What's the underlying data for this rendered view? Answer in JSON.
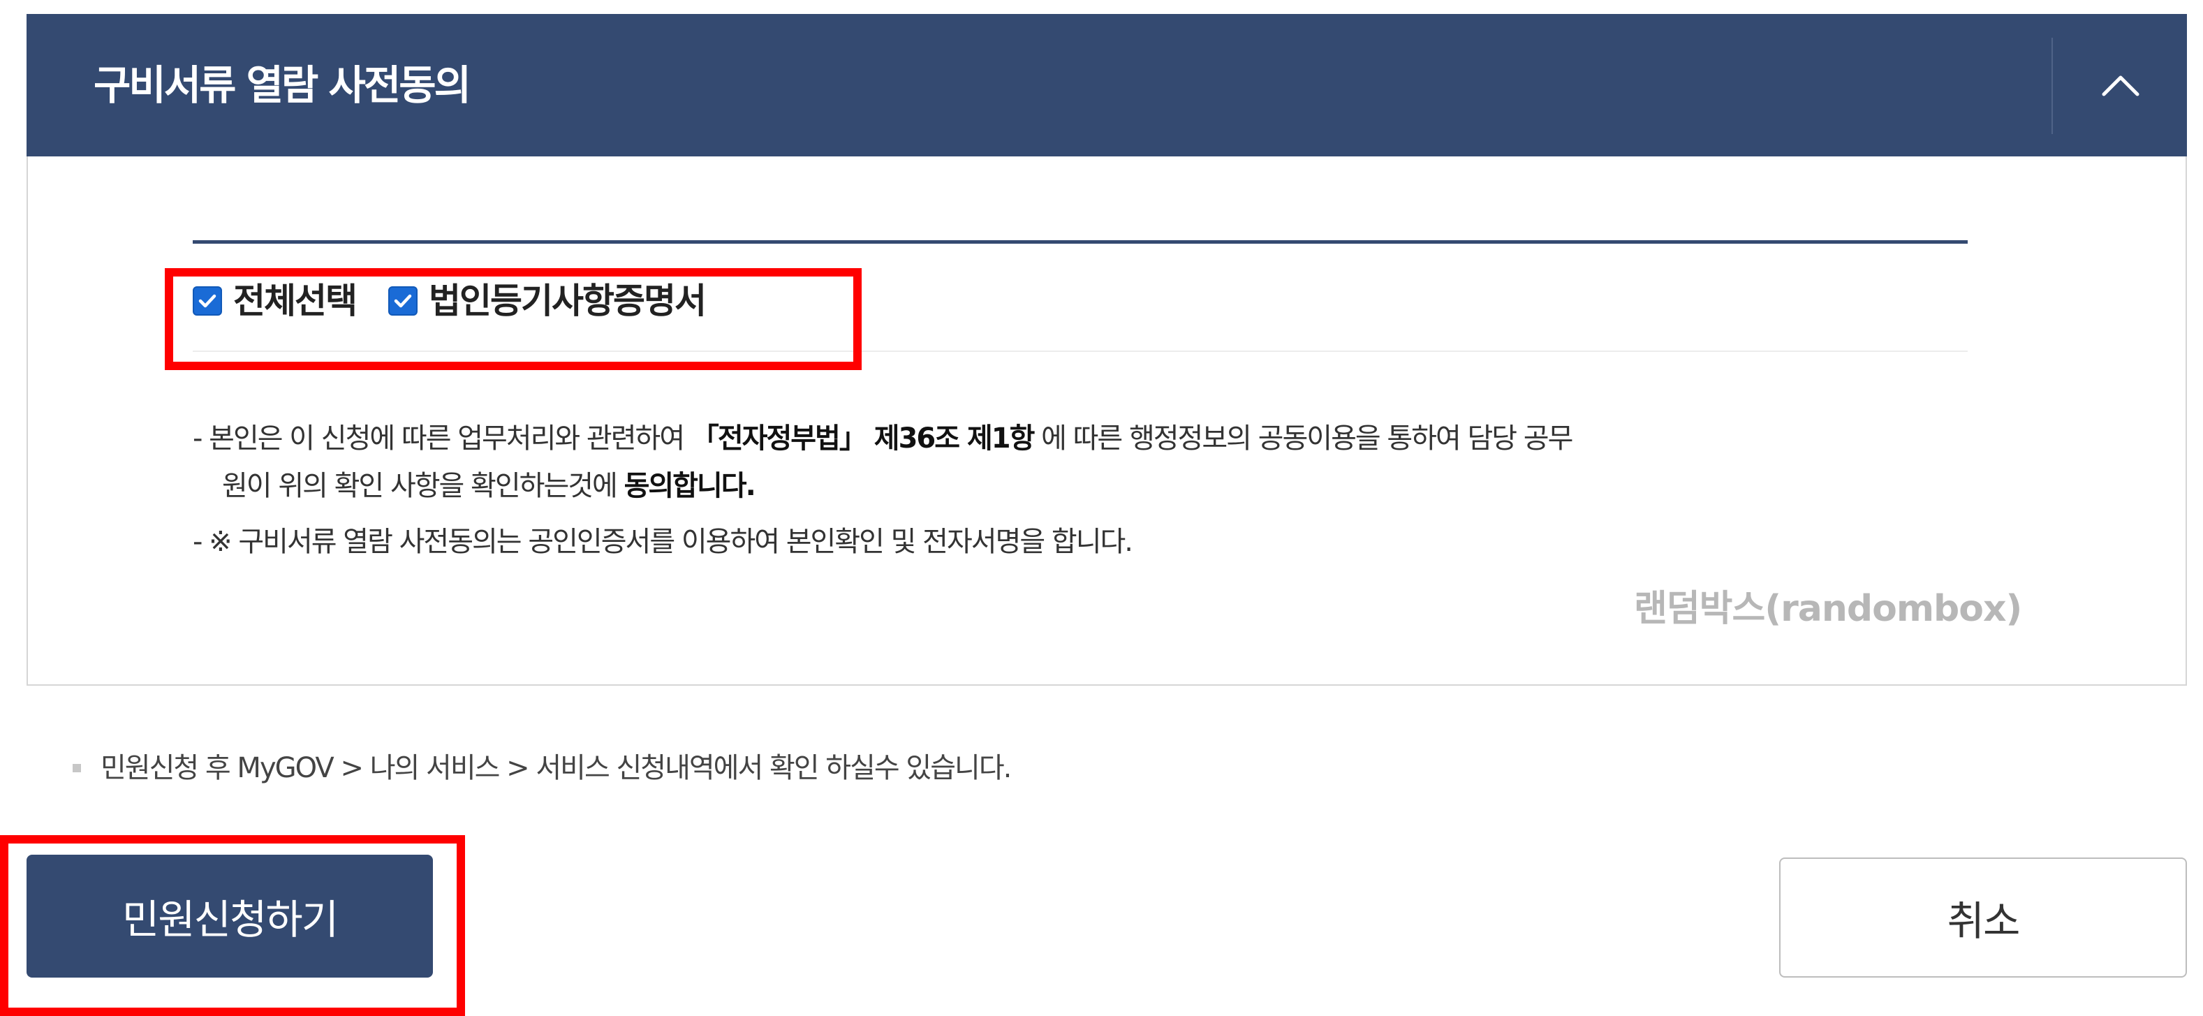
{
  "panel": {
    "title": "구비서류 열람 사전동의",
    "toggle_icon": "chevron-up-icon",
    "checkboxes": [
      {
        "label": "전체선택",
        "checked": true
      },
      {
        "label": "법인등기사항증명서",
        "checked": true
      }
    ],
    "notice": {
      "line1_pre": "- 본인은 이 신청에 따른 업무처리와 관련하여 ",
      "line1_bold1": "「전자정부법」 제36조 제1항",
      "line1_post": " 에 따른 행정정보의 공동이용을 통하여 담당 공무",
      "line2_pre": "원이 위의 확인 사항을 확인하는것에 ",
      "line2_bold": "동의합니다.",
      "line3": "- ※ 구비서류 열람 사전동의는 공인인증서를 이용하여 본인확인 및 전자서명을 합니다."
    },
    "watermark": "랜덤박스(randombox)"
  },
  "info_text": "민원신청 후 MyGOV > 나의 서비스 > 서비스 신청내역에서 확인 하실수 있습니다.",
  "buttons": {
    "submit_label": "민원신청하기",
    "cancel_label": "취소"
  },
  "colors": {
    "header_bg": "#344a71",
    "checkbox": "#1a6bd6",
    "highlight": "#ff0000"
  }
}
